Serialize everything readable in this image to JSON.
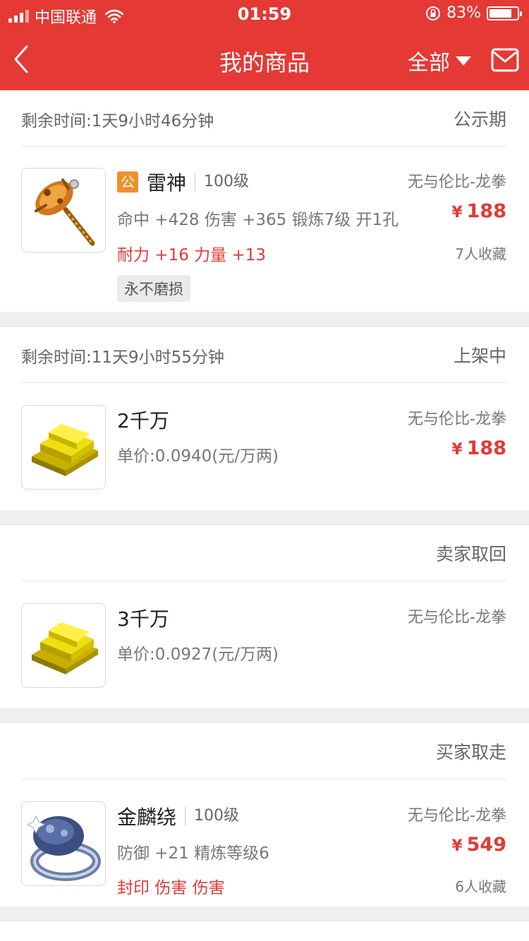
{
  "status": {
    "carrier": "中国联通",
    "time": "01:59",
    "battery": "83%",
    "battery_level": 0.83
  },
  "header": {
    "title": "我的商品",
    "filter": "全部"
  },
  "items": [
    {
      "remain": "剩余时间:1天9小时46分钟",
      "state": "公示期",
      "badge": "公",
      "name": "雷神",
      "level": "100级",
      "attrs": "命中 +428 伤害 +365 锻炼7级 开1孔",
      "red_attrs": "耐力 +16 力量 +13",
      "tag": "永不磨损",
      "server": "无与伦比-龙拳",
      "currency": "¥",
      "price": "188",
      "fav": "7人收藏",
      "icon": "hammer-icon"
    },
    {
      "remain": "剩余时间:11天9小时55分钟",
      "state": "上架中",
      "name": "2千万",
      "unit_price": "单价:0.0940(元/万两)",
      "server": "无与伦比-龙拳",
      "currency": "¥",
      "price": "188",
      "icon": "gold-bars-icon"
    },
    {
      "state": "卖家取回",
      "name": "3千万",
      "unit_price": "单价:0.0927(元/万两)",
      "server": "无与伦比-龙拳",
      "icon": "gold-bars-icon"
    },
    {
      "state": "买家取走",
      "name": "金麟绕",
      "level": "100级",
      "attrs": "防御 +21 精炼等级6",
      "red_attrs": "封印 伤害 伤害",
      "server": "无与伦比-龙拳",
      "currency": "¥",
      "price": "549",
      "fav": "6人收藏",
      "icon": "ring-icon"
    }
  ],
  "colors": {
    "brand": "#e53935",
    "badge": "#f0902b"
  }
}
